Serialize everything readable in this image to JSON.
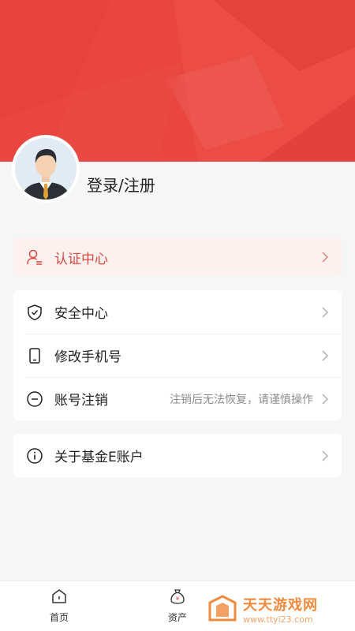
{
  "profile": {
    "login_label": "登录/注册"
  },
  "auth_item": {
    "label": "认证中心"
  },
  "menu": [
    {
      "label": "安全中心",
      "hint": ""
    },
    {
      "label": "修改手机号",
      "hint": ""
    },
    {
      "label": "账号注销",
      "hint": "注销后无法恢复，请谨慎操作"
    }
  ],
  "about": {
    "label": "关于基金E账户"
  },
  "tabbar": {
    "home_label": "首页",
    "assets_label": "资产"
  },
  "watermark": {
    "title": "天天游戏网",
    "url": "www.ttyl23.com"
  },
  "colors": {
    "brand": "#e8463f",
    "auth_bg": "#fdf1ef",
    "auth_text": "#d94a41"
  }
}
